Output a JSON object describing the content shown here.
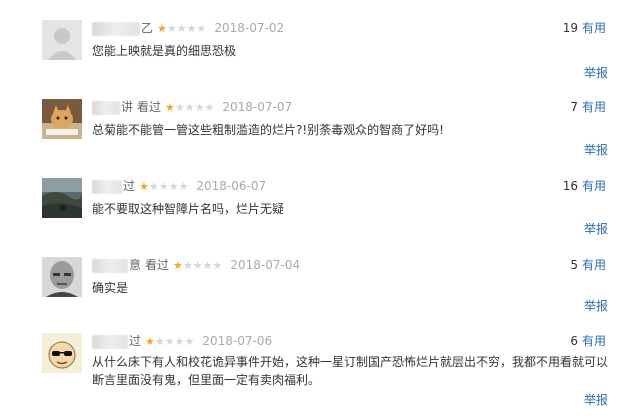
{
  "reviews": [
    {
      "name_fragment": "乙",
      "watched": "",
      "rating": 1,
      "date": "2018-07-02",
      "useful_count": "19",
      "useful_label": "有用",
      "content": "您能上映就是真的细思恐极",
      "report_label": "举报",
      "avatar": "default-avatar"
    },
    {
      "name_fragment": "讲",
      "watched": "看过",
      "rating": 1,
      "date": "2018-07-07",
      "useful_count": "7",
      "useful_label": "有用",
      "content": "总菊能不能管一管这些粗制滥造的烂片?!别荼毒观众的智商了好吗!",
      "report_label": "举报",
      "avatar": "cat-photo"
    },
    {
      "name_fragment": "过",
      "watched": "",
      "rating": 1,
      "date": "2018-06-07",
      "useful_count": "16",
      "useful_label": "有用",
      "content": "能不要取这种智障片名吗，烂片无疑",
      "report_label": "举报",
      "avatar": "landscape-photo"
    },
    {
      "name_fragment": "意",
      "watched": "看过",
      "rating": 1,
      "date": "2018-07-04",
      "useful_count": "5",
      "useful_label": "有用",
      "content": "确实是",
      "report_label": "举报",
      "avatar": "bald-man-photo"
    },
    {
      "name_fragment": "过",
      "watched": "",
      "rating": 1,
      "date": "2018-07-06",
      "useful_count": "6",
      "useful_label": "有用",
      "content": "从什么床下有人和校花诡异事件开始，这种一星订制国产恐怖烂片就层出不穷，我都不用看就可以断言里面没有鬼，但里面一定有卖肉福利。",
      "report_label": "举报",
      "avatar": "cartoon-sunglasses"
    }
  ],
  "colors": {
    "star_on": "#f5a623",
    "star_off": "#d6d6d6",
    "link": "#2b6cb0",
    "date": "#aaaaaa"
  }
}
